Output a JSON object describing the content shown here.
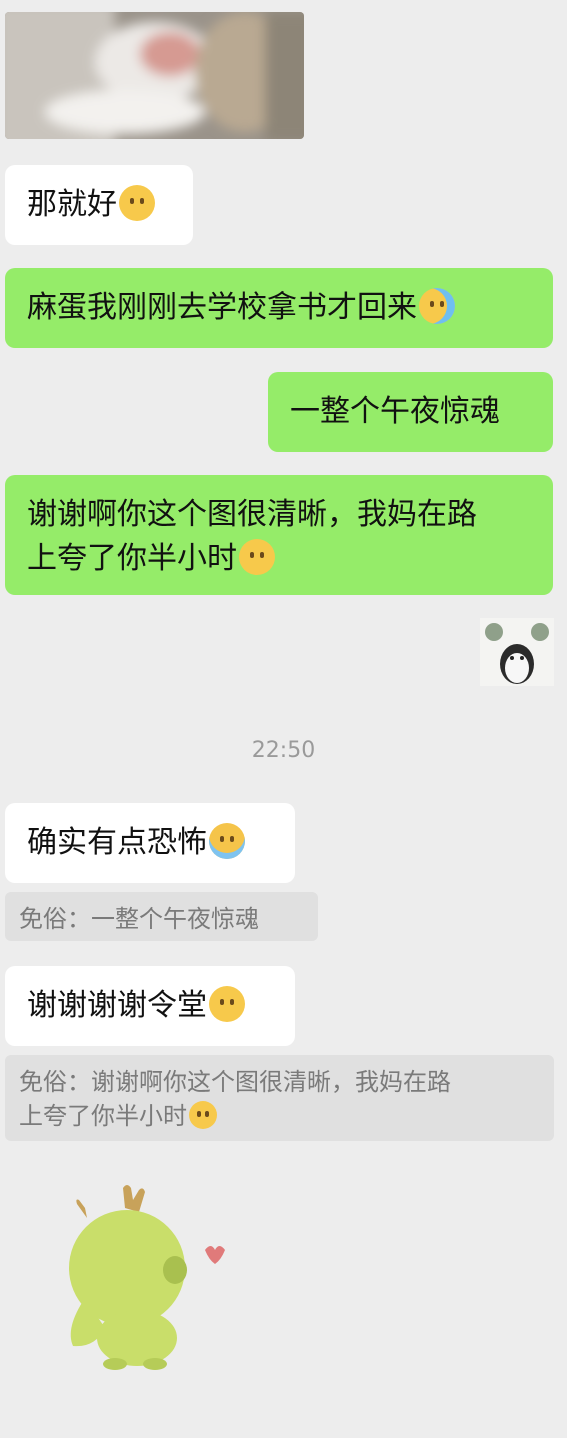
{
  "messages": {
    "m1": {
      "text": "那就好",
      "emoji": "pouting-face"
    },
    "m2": {
      "text": "麻蛋我刚刚去学校拿书才回来",
      "emoji": "tears-of-joy-face"
    },
    "m3": {
      "text": "一整个午夜惊魂"
    },
    "m4": {
      "text_line1": "谢谢啊你这个图很清晰，我妈在路",
      "text_line2": "上夸了你半小时",
      "emoji": "pleading-face"
    },
    "timestamp": "22:50",
    "m5": {
      "text": "确实有点恐怖",
      "emoji": "loudly-crying-face"
    },
    "q5": {
      "prefix": "免俗：",
      "text": "一整个午夜惊魂"
    },
    "m6": {
      "text": "谢谢谢谢令堂",
      "emoji": "pouting-face"
    },
    "q6": {
      "prefix": "免俗：",
      "text_line1": "谢谢啊你这个图很清晰，我妈在路",
      "text_line2": "上夸了你半小时",
      "emoji": "pleading-face"
    }
  },
  "colors": {
    "background": "#ededed",
    "sent_bubble": "#95ec69",
    "received_bubble": "#ffffff",
    "quote_block": "#e0e0e0"
  }
}
